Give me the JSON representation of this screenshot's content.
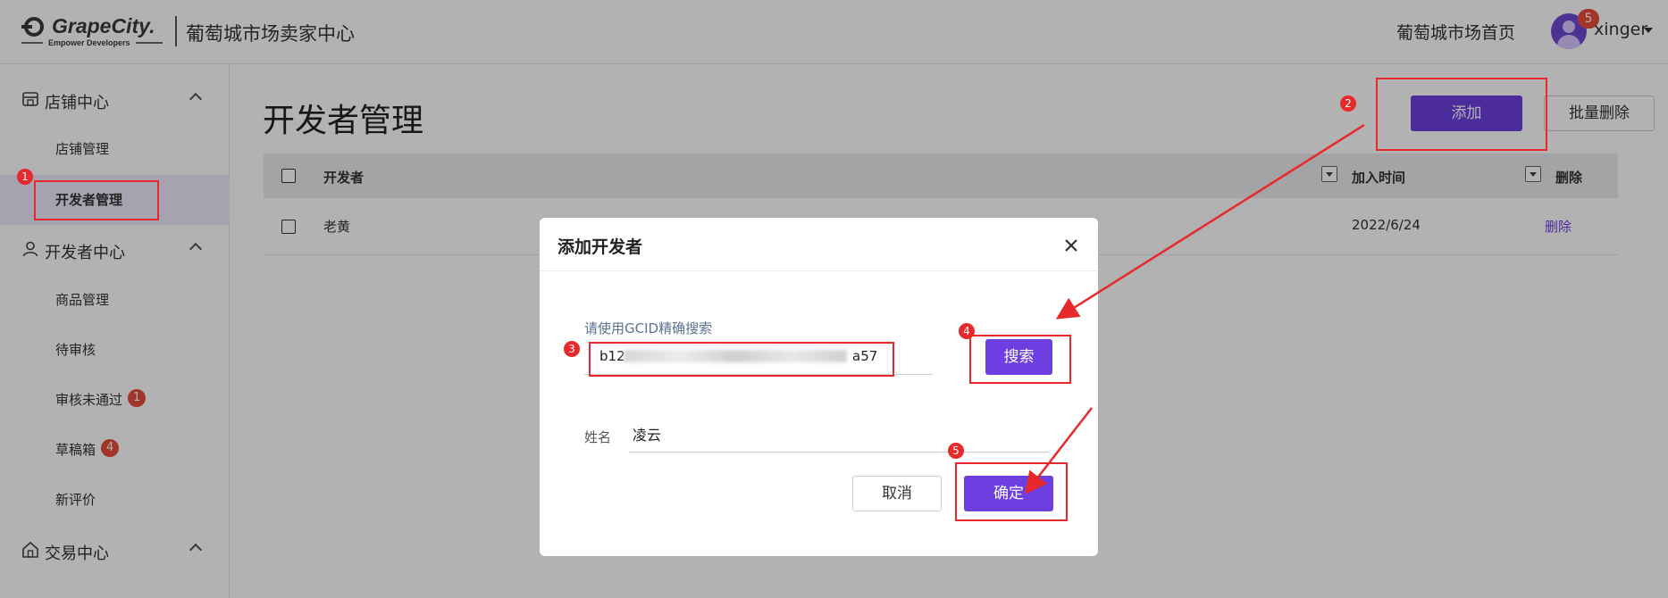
{
  "header": {
    "logo_text": "GrapeCity.",
    "logo_tagline": "Empower Developers",
    "site_title": "葡萄城市场卖家中心",
    "home_link": "葡萄城市场首页",
    "notification_count": "5",
    "username": "xinger"
  },
  "sidebar": {
    "groups": [
      {
        "label": "店铺中心",
        "icon": "store-icon",
        "items": [
          {
            "label": "店铺管理"
          },
          {
            "label": "开发者管理",
            "active": true
          }
        ]
      },
      {
        "label": "开发者中心",
        "icon": "user-icon",
        "items": [
          {
            "label": "商品管理"
          },
          {
            "label": "待审核"
          },
          {
            "label": "审核未通过",
            "badge": "1"
          },
          {
            "label": "草稿箱",
            "badge": "4"
          },
          {
            "label": "新评价"
          }
        ]
      },
      {
        "label": "交易中心",
        "icon": "house-icon",
        "items": []
      }
    ]
  },
  "main": {
    "page_title": "开发者管理",
    "add_button": "添加",
    "batch_delete_button": "批量删除",
    "table": {
      "columns": [
        "开发者",
        "加入时间",
        "删除"
      ],
      "rows": [
        {
          "developer": "老黄",
          "joined": "2022/6/24",
          "action": "删除"
        }
      ]
    }
  },
  "modal": {
    "title": "添加开发者",
    "search_hint": "请使用GCID精确搜索",
    "search_value_start": "b12",
    "search_value_end": "a57",
    "search_button": "搜索",
    "name_label": "姓名",
    "name_value": "凌云",
    "cancel_button": "取消",
    "confirm_button": "确定"
  },
  "annotations": {
    "color": "#e8292b",
    "steps": [
      "1",
      "2",
      "3",
      "4",
      "5"
    ]
  },
  "theme": {
    "primary": "#6e3fe0",
    "badge": "#e74c3c"
  }
}
